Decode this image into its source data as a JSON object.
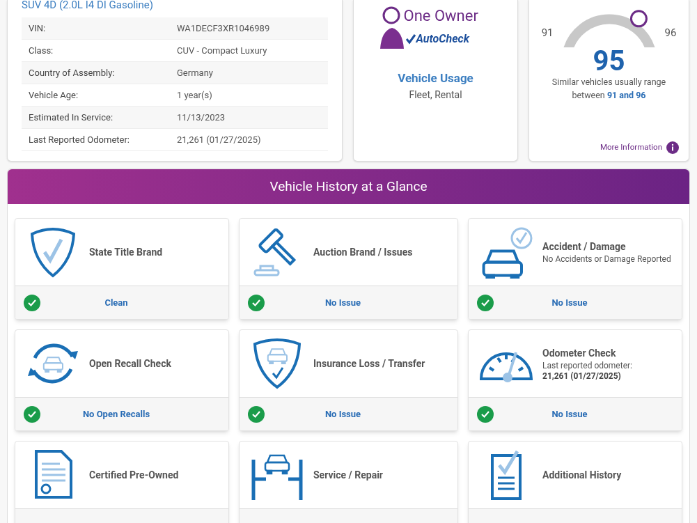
{
  "vehicle": {
    "title": "SUV 4D (2.0L I4 DI Gasoline)",
    "specs": [
      {
        "label": "VIN:",
        "value": "WA1DECF3XR1046989"
      },
      {
        "label": "Class:",
        "value": "CUV - Compact Luxury"
      },
      {
        "label": "Country of Assembly:",
        "value": "Germany"
      },
      {
        "label": "Vehicle Age:",
        "value": "1 year(s)"
      },
      {
        "label": "Estimated In Service:",
        "value": "11/13/2023"
      },
      {
        "label": "Last Reported Odometer:",
        "value": "21,261 (01/27/2025)"
      }
    ]
  },
  "usage": {
    "logo_title": "One Owner",
    "logo_sub": "AutoCheck",
    "heading": "Vehicle Usage",
    "value": "Fleet, Rental"
  },
  "score": {
    "min": "91",
    "max": "96",
    "value": "95",
    "level": 0.8,
    "note": "Similar vehicles usually range between",
    "note_highlight": "91 and 96",
    "link": "More Information"
  },
  "glance": {
    "title": "Vehicle History at a Glance",
    "cards": [
      {
        "title": "State Title Brand",
        "passed": true,
        "result": "Clean"
      },
      {
        "title": "Auction Brand / Issues",
        "passed": true,
        "result": "No Issue"
      },
      {
        "title": "Accident / Damage",
        "subtitle": "No Accidents or Damage Reported",
        "passed": true,
        "result": "No Issue"
      },
      {
        "title": "Open Recall Check",
        "passed": true,
        "result": "No Open Recalls"
      },
      {
        "title": "Insurance Loss / Transfer",
        "passed": true,
        "result": "No Issue"
      },
      {
        "title": "Odometer Check",
        "subtitle": "Last reported odometer:",
        "subtitle_bold": "21,261 (01/27/2025)",
        "passed": true,
        "result": "No Issue"
      },
      {
        "title": "Certified Pre-Owned"
      },
      {
        "title": "Service / Repair"
      },
      {
        "title": "Additional History"
      }
    ]
  }
}
